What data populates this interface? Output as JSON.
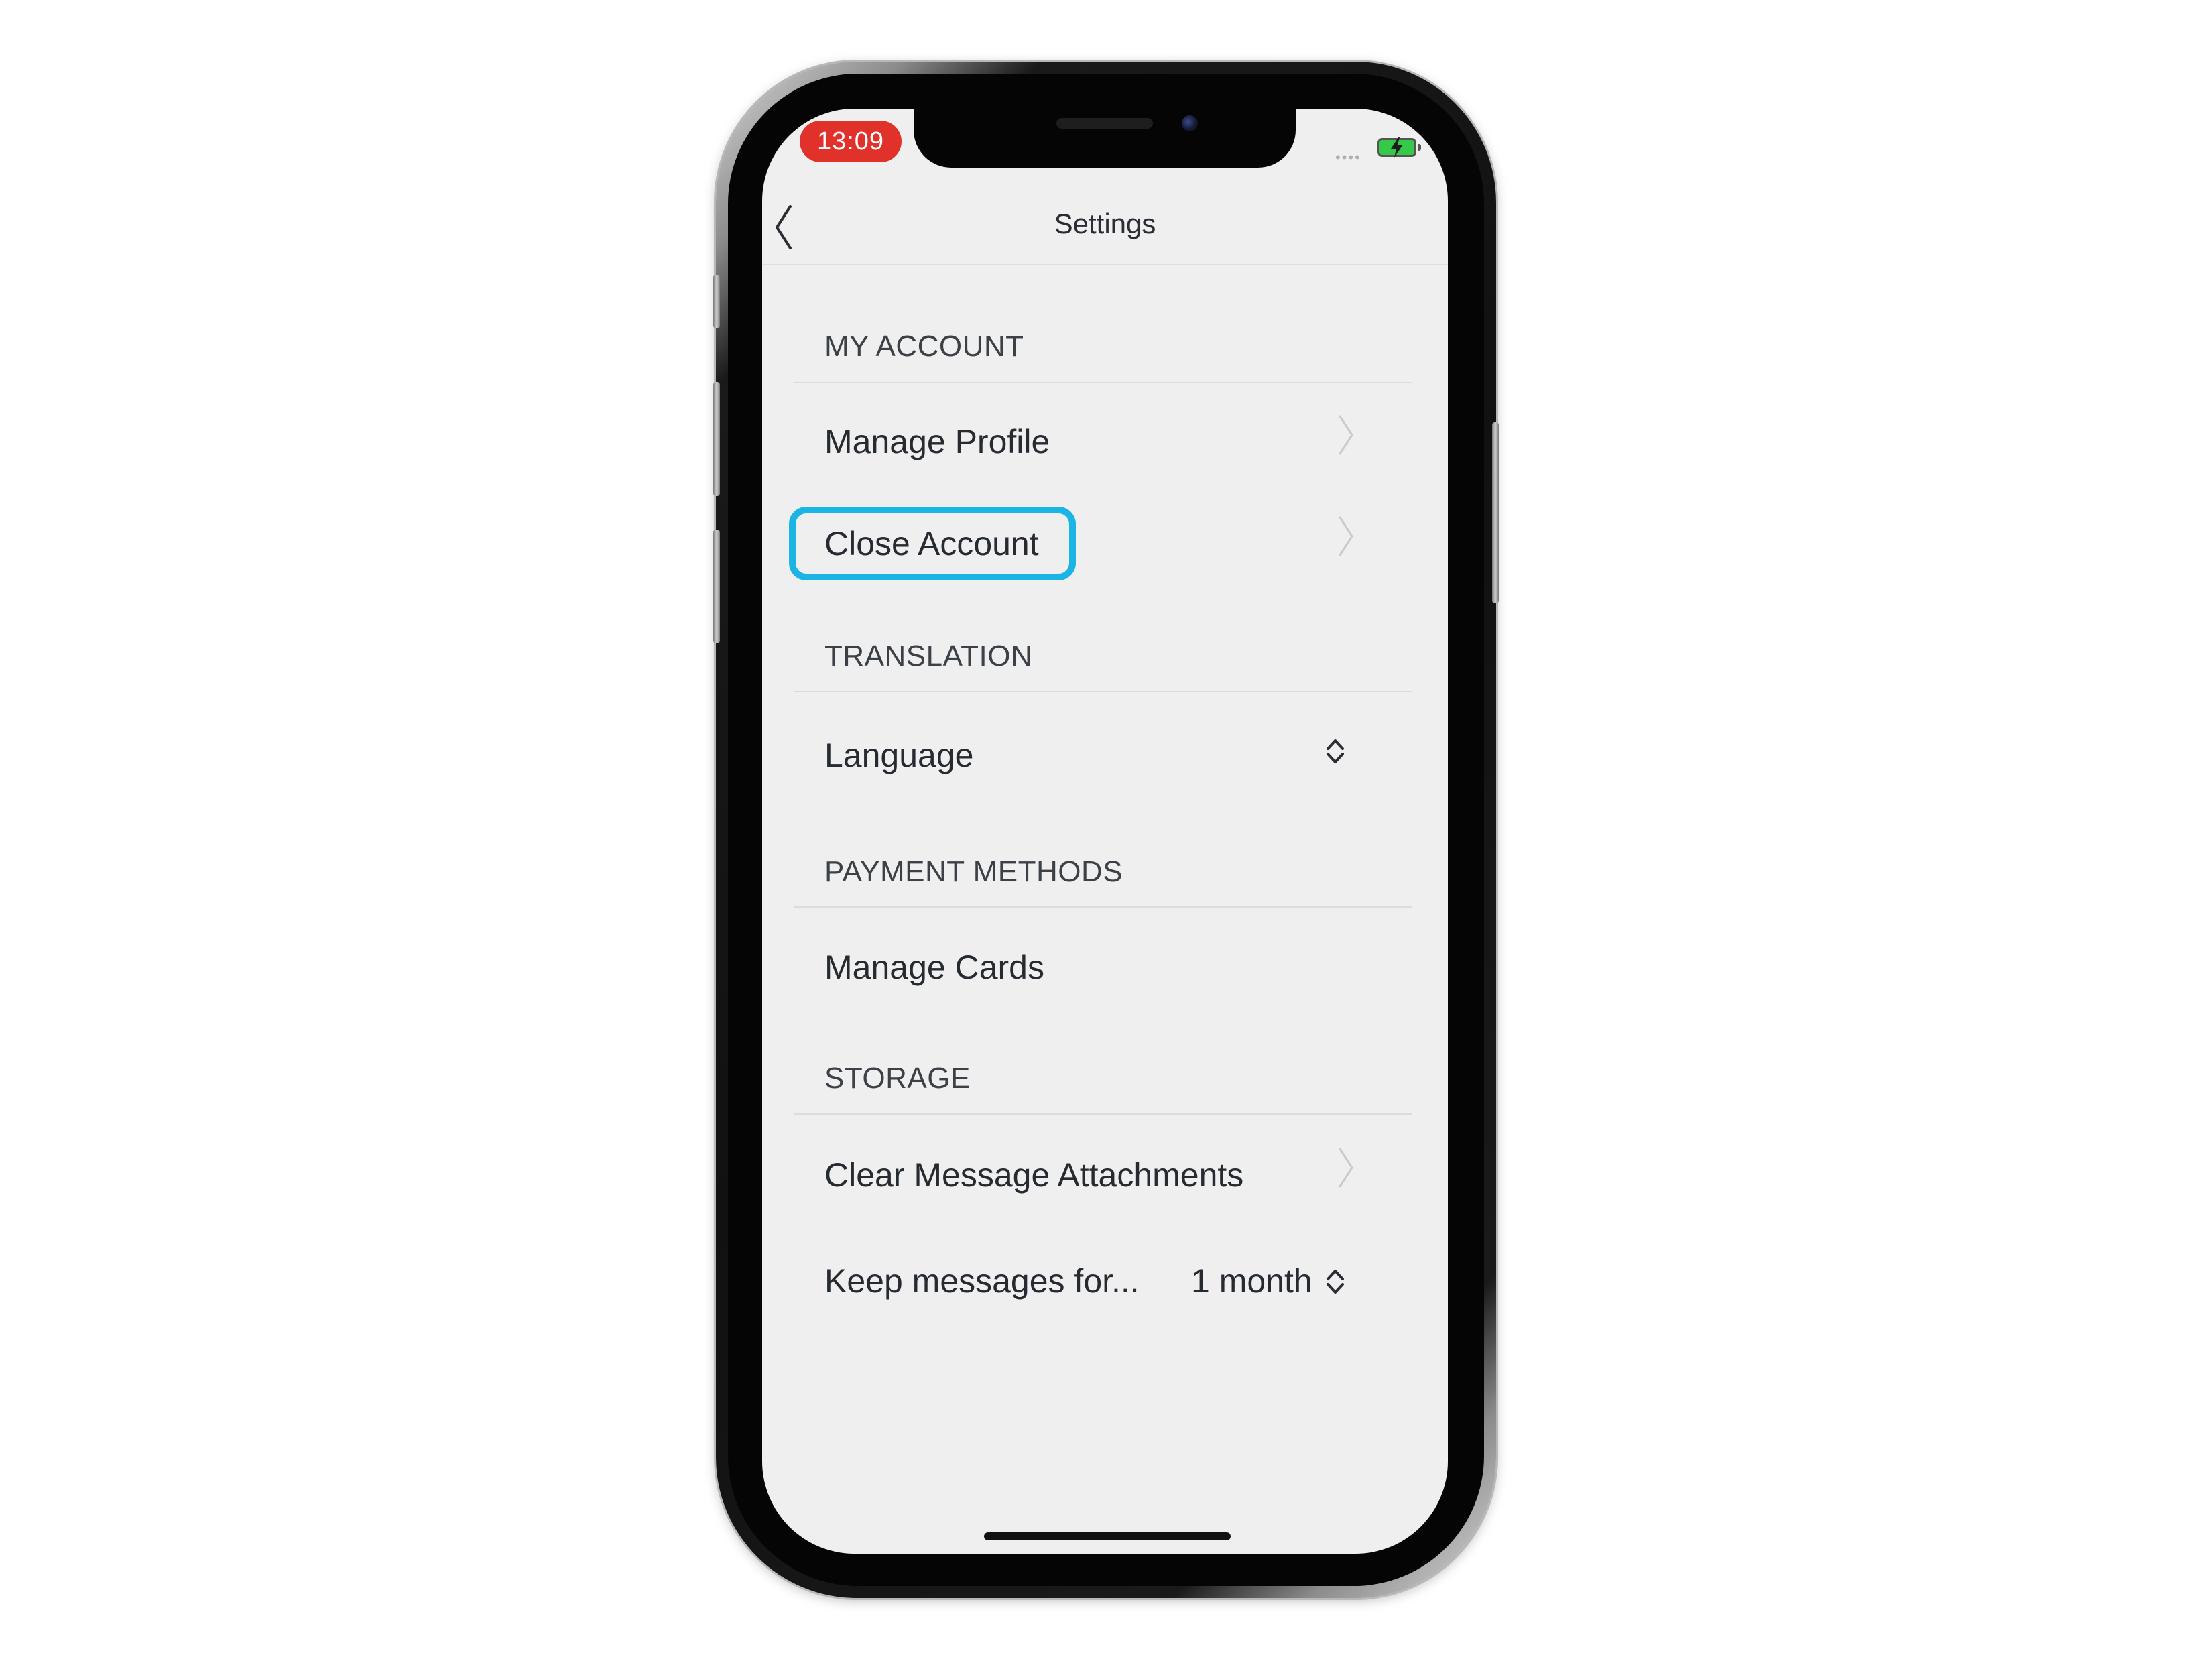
{
  "status_bar": {
    "time": "13:09",
    "signal_dots": "••••"
  },
  "nav": {
    "title": "Settings"
  },
  "sections": {
    "my_account": {
      "header": "MY ACCOUNT",
      "manage_profile": "Manage Profile",
      "close_account": "Close Account"
    },
    "translation": {
      "header": "TRANSLATION",
      "language": "Language"
    },
    "payment_methods": {
      "header": "PAYMENT METHODS",
      "manage_cards": "Manage Cards"
    },
    "storage": {
      "header": "STORAGE",
      "clear_attachments": "Clear Message Attachments",
      "keep_messages": "Keep messages for...",
      "keep_messages_value": "1 month"
    }
  },
  "colors": {
    "highlight": "#1ab5e4",
    "time_pill": "#e0322b",
    "screen_bg": "#efefef",
    "battery": "#35c94a"
  }
}
